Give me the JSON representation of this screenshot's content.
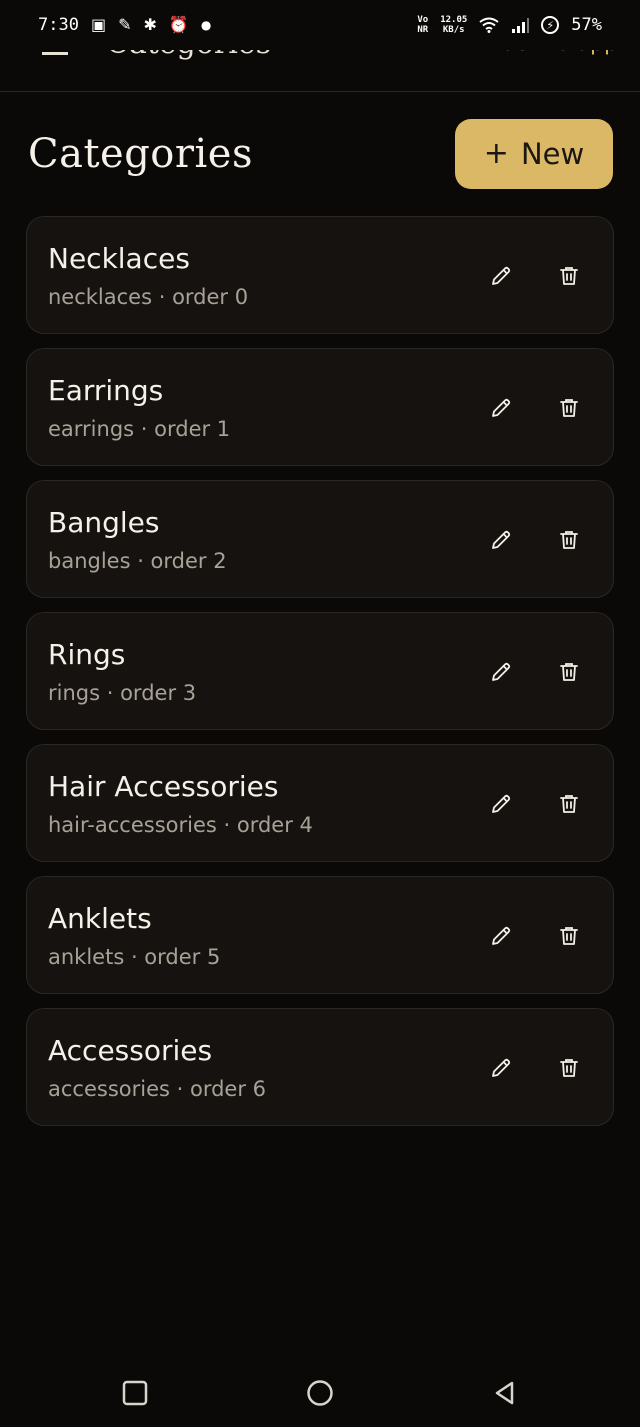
{
  "status_bar": {
    "time": "7:30",
    "network_top": "Vo",
    "network_bottom": "NR",
    "speed_top": "12.05",
    "speed_bottom": "KB/s",
    "battery": "57%"
  },
  "header": {
    "title": "Categories",
    "back_link": "Back to app"
  },
  "page": {
    "title": "Categories",
    "new_button_label": "New"
  },
  "categories": [
    {
      "name": "Necklaces",
      "meta": "necklaces · order 0"
    },
    {
      "name": "Earrings",
      "meta": "earrings · order 1"
    },
    {
      "name": "Bangles",
      "meta": "bangles · order 2"
    },
    {
      "name": "Rings",
      "meta": "rings · order 3"
    },
    {
      "name": "Hair Accessories",
      "meta": "hair-accessories · order 4"
    },
    {
      "name": "Anklets",
      "meta": "anklets · order 5"
    },
    {
      "name": "Accessories",
      "meta": "accessories · order 6"
    }
  ],
  "colors": {
    "accent": "#dbb866",
    "background": "#0a0908",
    "card": "#15120f",
    "card_border": "#2b2722"
  },
  "icons": {
    "edit": "pencil-icon",
    "delete": "trash-icon",
    "menu": "hamburger-menu-icon"
  }
}
